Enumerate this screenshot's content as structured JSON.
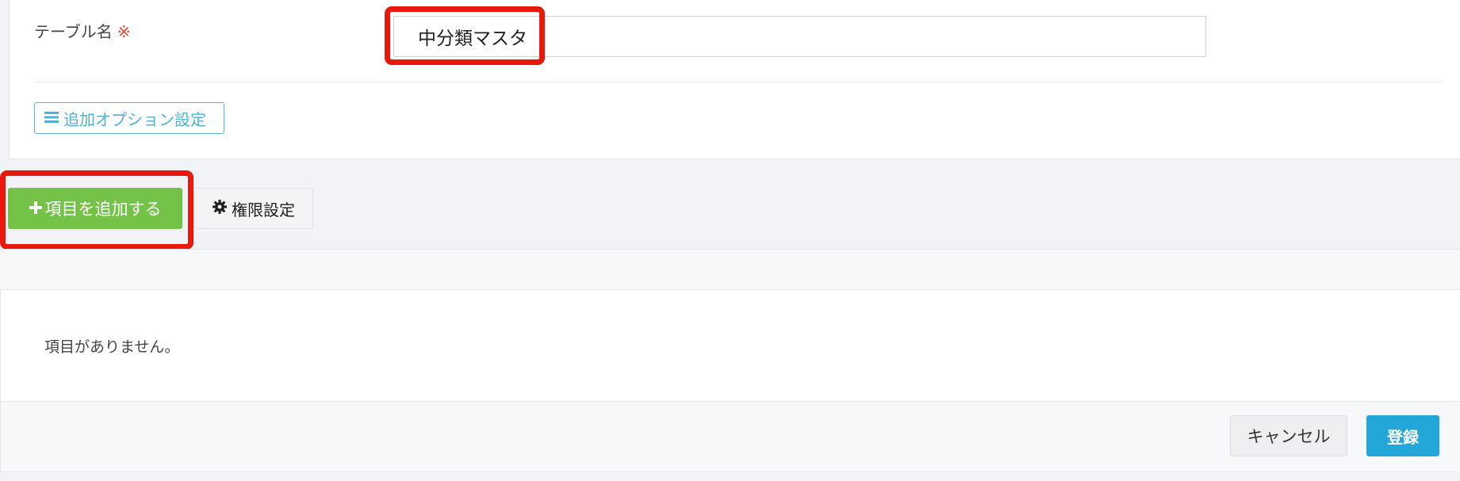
{
  "form": {
    "table_name_label": "テーブル名",
    "required_mark": "※",
    "table_name_value": "中分類マスタ",
    "options_button_label": "追加オプション設定"
  },
  "toolbar": {
    "add_item_label": "項目を追加する",
    "permissions_label": "権限設定"
  },
  "list": {
    "empty_message": "項目がありません。"
  },
  "footer": {
    "cancel_label": "キャンセル",
    "submit_label": "登録"
  },
  "icons": {
    "options": "list-icon",
    "add": "plus-icon",
    "permissions": "gear-icon"
  },
  "colors": {
    "add_button": "#75c249",
    "submit_button": "#23a7d9",
    "highlight": "#e8180c",
    "options_accent": "#4eb1d8",
    "required_mark": "#e0453a"
  }
}
